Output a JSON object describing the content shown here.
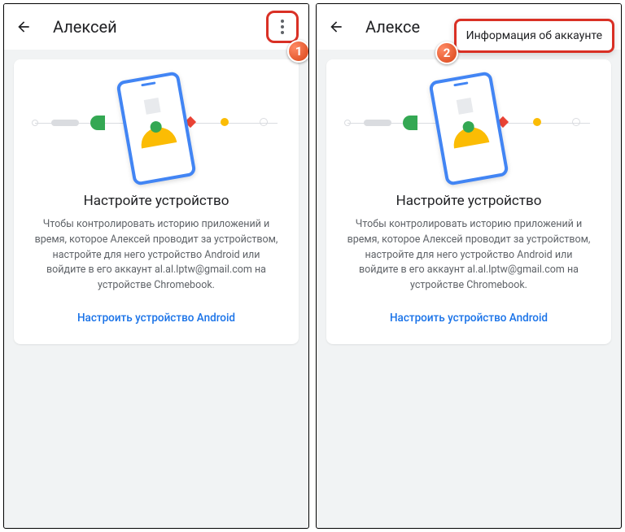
{
  "left": {
    "title": "Алексей",
    "badge": "1",
    "card": {
      "heading": "Настройте устройство",
      "body": "Чтобы контролировать историю приложений и время, которое Алексей проводит за устройством, настройте для него устройство Android или войдите в его аккаунт al.al.lptw@gmail.com на устройстве Chromebook.",
      "link": "Настроить устройство Android"
    }
  },
  "right": {
    "title": "Алексе",
    "badge": "2",
    "menu_item": "Информация об аккаунте",
    "card": {
      "heading": "Настройте устройство",
      "body": "Чтобы контролировать историю приложений и время, которое Алексей проводит за устройством, настройте для него устройство Android или войдите в его аккаунт al.al.lptw@gmail.com на устройстве Chromebook.",
      "link": "Настроить устройство Android"
    }
  }
}
